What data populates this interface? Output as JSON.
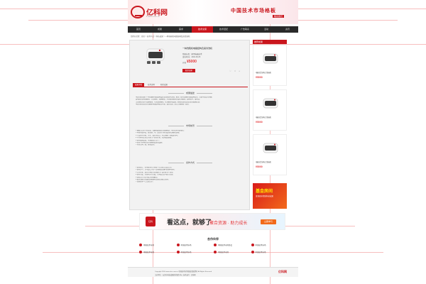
{
  "header": {
    "logo_text": "亿科网",
    "logo_url": "1.ekcs.com.cn",
    "slogan": "中国技术市场格板",
    "slogan_sub": "联系我们"
  },
  "nav": [
    {
      "label": "首页",
      "active": false
    },
    {
      "label": "成果",
      "active": false
    },
    {
      "label": "需求",
      "active": false
    },
    {
      "label": "技术交易",
      "active": true
    },
    {
      "label": "技术经纪",
      "active": false
    },
    {
      "label": "广告联系",
      "active": false
    },
    {
      "label": "活动",
      "active": false
    },
    {
      "label": "资讯",
      "active": false
    }
  ],
  "breadcrumb": "您所在位置：首页 > 技术产品 > 科技成果 > 一种洗碗机电路结构及其清洗机",
  "product": {
    "title": "一种洗碗机电路结构及其清洗机",
    "meta": "所属分类：家用电器技术",
    "meta2": "发布时间：2016-06-05",
    "price_label": "价格",
    "price": "¥5000",
    "contact": "联系卖家",
    "icons": [
      "♡",
      "☆",
      "⌂"
    ]
  },
  "tabs": [
    {
      "label": "成果详情",
      "active": true
    },
    {
      "label": "技术说明",
      "active": false
    },
    {
      "label": "相关成果",
      "active": false
    }
  ],
  "sections": [
    {
      "title": "成果描述",
      "lines": [
        "本实用新型属于一种洗碗机电路结构及其清洗机技术领域，解决了现有洗碗机电路结构复杂、控制不稳定的问题。",
        "该电路包括电源模块、主控模块、加热模块、水泵驱动模块以及检测模块，结构简单，成本低。",
        "主控模块分别与加热模块、水泵驱动模块、检测模块电连接，能够实现对清洗过程的精确控制。",
        "本实用新型提供的洗碗机电路结构稳定可靠，安全性高，适合大规模推广使用。"
      ]
    },
    {
      "title": "市场前景",
      "lines": [
        "1.随着生活水平的提高，洗碗机逐渐进入普通家庭，市场需求持续增长。",
        "2.本技术成本低、易实施，可广泛应用于家用及商用洗碗机领域。",
        "3.产品具有节能、节水、安全等优点，符合国家产业政策导向。",
        "4.可与家电企业合作进行产业化开发，经济效益显著。",
        "5.技术成熟度高，可直接投入生产。",
        "6.适用于各种类型的洗碗机及清洗设备。",
        "7.市场空间广阔，前景良好。"
      ]
    },
    {
      "title": "合作方式",
      "lines": [
        "1.技术转让：将本技术的专利权一次性转让给受让方。",
        "2.技术许可：许可受让方在一定期限及范围内实施本技术。",
        "3.合作开发：双方共同投入资源进行产品开发与产业化。",
        "4.技术入股：以技术作价入股，共同成立公司进行经营。",
        "5.其他合作方式可双方协商确定。",
        "6.联系请拨打页面底部客服电话或在线留言咨询。",
        "7.欢迎各界人士洽谈合作。"
      ]
    }
  ],
  "sidebar": {
    "heading": "推荐成果",
    "items": [
      {
        "title": "电器式活动电力洗碗机",
        "price": "¥5000"
      },
      {
        "title": "电器式活动电力洗碗机",
        "price": "¥5000"
      },
      {
        "title": "电器式活动电力洗碗机",
        "price": "¥5000"
      }
    ],
    "promo_title": "基金房间",
    "promo_sub": "发现更多优质科技成果"
  },
  "banner": {
    "icon_label": "亿科",
    "text": "看这点，就够了",
    "text2": "聚合资源 · 助力成长",
    "button": "立即参与"
  },
  "partners": {
    "title": "合作伙伴",
    "items": [
      "中国技术市场",
      "中国技术市场",
      "中国技术市场协会",
      "中国技术市场",
      "中国技术市场",
      "中国技术市场",
      "中国技术市场",
      "中国技术市场"
    ]
  },
  "footer": {
    "line1": "Copyright 2016 www.ekcs.com.cn 中国技术市场格板 版权所有 All Rights Reserved",
    "line2": "主办单位：天津市科技成果转化服务中心 技术支持：亿科网",
    "logo": "亿科网"
  }
}
